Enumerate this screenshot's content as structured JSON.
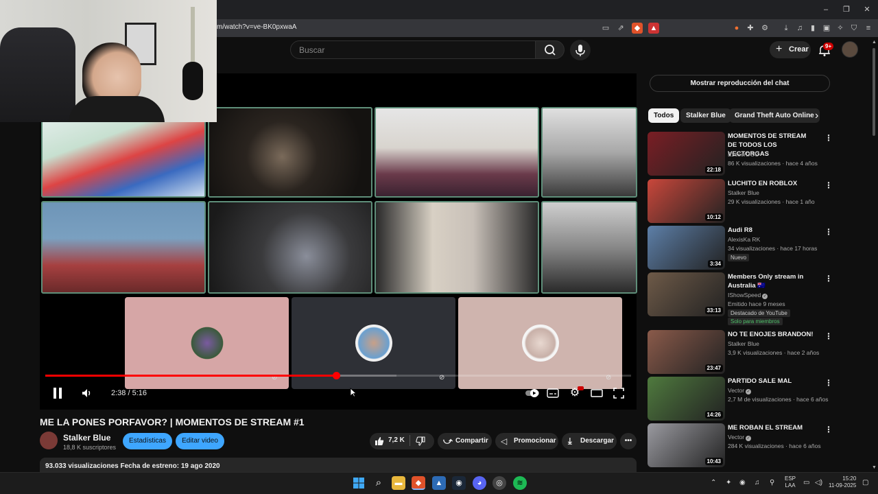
{
  "browser": {
    "url": "m/watch?v=ve-BK0pxwaA",
    "win_min": "–",
    "win_max": "❐",
    "win_close": "✕"
  },
  "header": {
    "search_placeholder": "Buscar",
    "create_label": "Crear",
    "notif_badge": "9+"
  },
  "player": {
    "time": "2:38 / 5:16",
    "progress_fraction": 0.497
  },
  "video": {
    "title": "ME LA PONES PORFAVOR? | MOMENTOS DE STREAM #1",
    "channel": "Stalker Blue",
    "subscribers": "18,8 K suscriptores",
    "stats_button": "Estadísticas",
    "edit_button": "Editar video",
    "likes": "7,2 K",
    "share": "Compartir",
    "promote": "Promocionar",
    "download": "Descargar",
    "views_line": "93.033 visualizaciones  Fecha de estreno: 19 ago 2020"
  },
  "sidebar": {
    "chat_replay": "Mostrar reproducción del chat",
    "chips": [
      "Todos",
      "Stalker Blue",
      "Grand Theft Auto Online"
    ],
    "recommendations": [
      {
        "title": "MOMENTOS DE STREAM DE TODOS LOS VECTORGAS",
        "channel": "EzeserDOU",
        "meta": "86 K visualizaciones · hace 4 años",
        "duration": "22:18",
        "color": "#7a1e24"
      },
      {
        "title": "LUCHITO EN ROBLOX",
        "channel": "Stalker Blue",
        "meta": "29 K visualizaciones · hace 1 año",
        "duration": "10:12",
        "color": "#c9473b"
      },
      {
        "title": "Audi R8",
        "channel": "AlexisKa RK",
        "meta": "34 visualizaciones · hace 17 horas",
        "duration": "3:34",
        "badge": "Nuevo",
        "color": "#5d7fa8"
      },
      {
        "title": "Members Only stream in Australia 🇦🇺",
        "channel": "IShowSpeed",
        "meta": "Emitido hace 9 meses",
        "duration": "33:13",
        "badge": "Destacado de YouTube",
        "extra": "Solo para miembros",
        "color": "#6e5a48"
      },
      {
        "title": "NO TE ENOJES BRANDON!",
        "channel": "Stalker Blue",
        "meta": "3,9 K visualizaciones · hace 2 años",
        "duration": "23:47",
        "color": "#8a5a4a"
      },
      {
        "title": "PARTIDO SALE MAL",
        "channel": "Vector",
        "meta": "2,7 M de visualizaciones · hace 6 años",
        "duration": "14:26",
        "color": "#4f7a3e"
      },
      {
        "title": "ME ROBAN EL STREAM",
        "channel": "Vector",
        "meta": "284 K visualizaciones · hace 6 años",
        "duration": "10:43",
        "color": "#9a9aa0"
      }
    ]
  },
  "taskbar": {
    "lang": "ESP",
    "lang2": "LAA",
    "time": "15:20",
    "date": "11-09-2025"
  }
}
